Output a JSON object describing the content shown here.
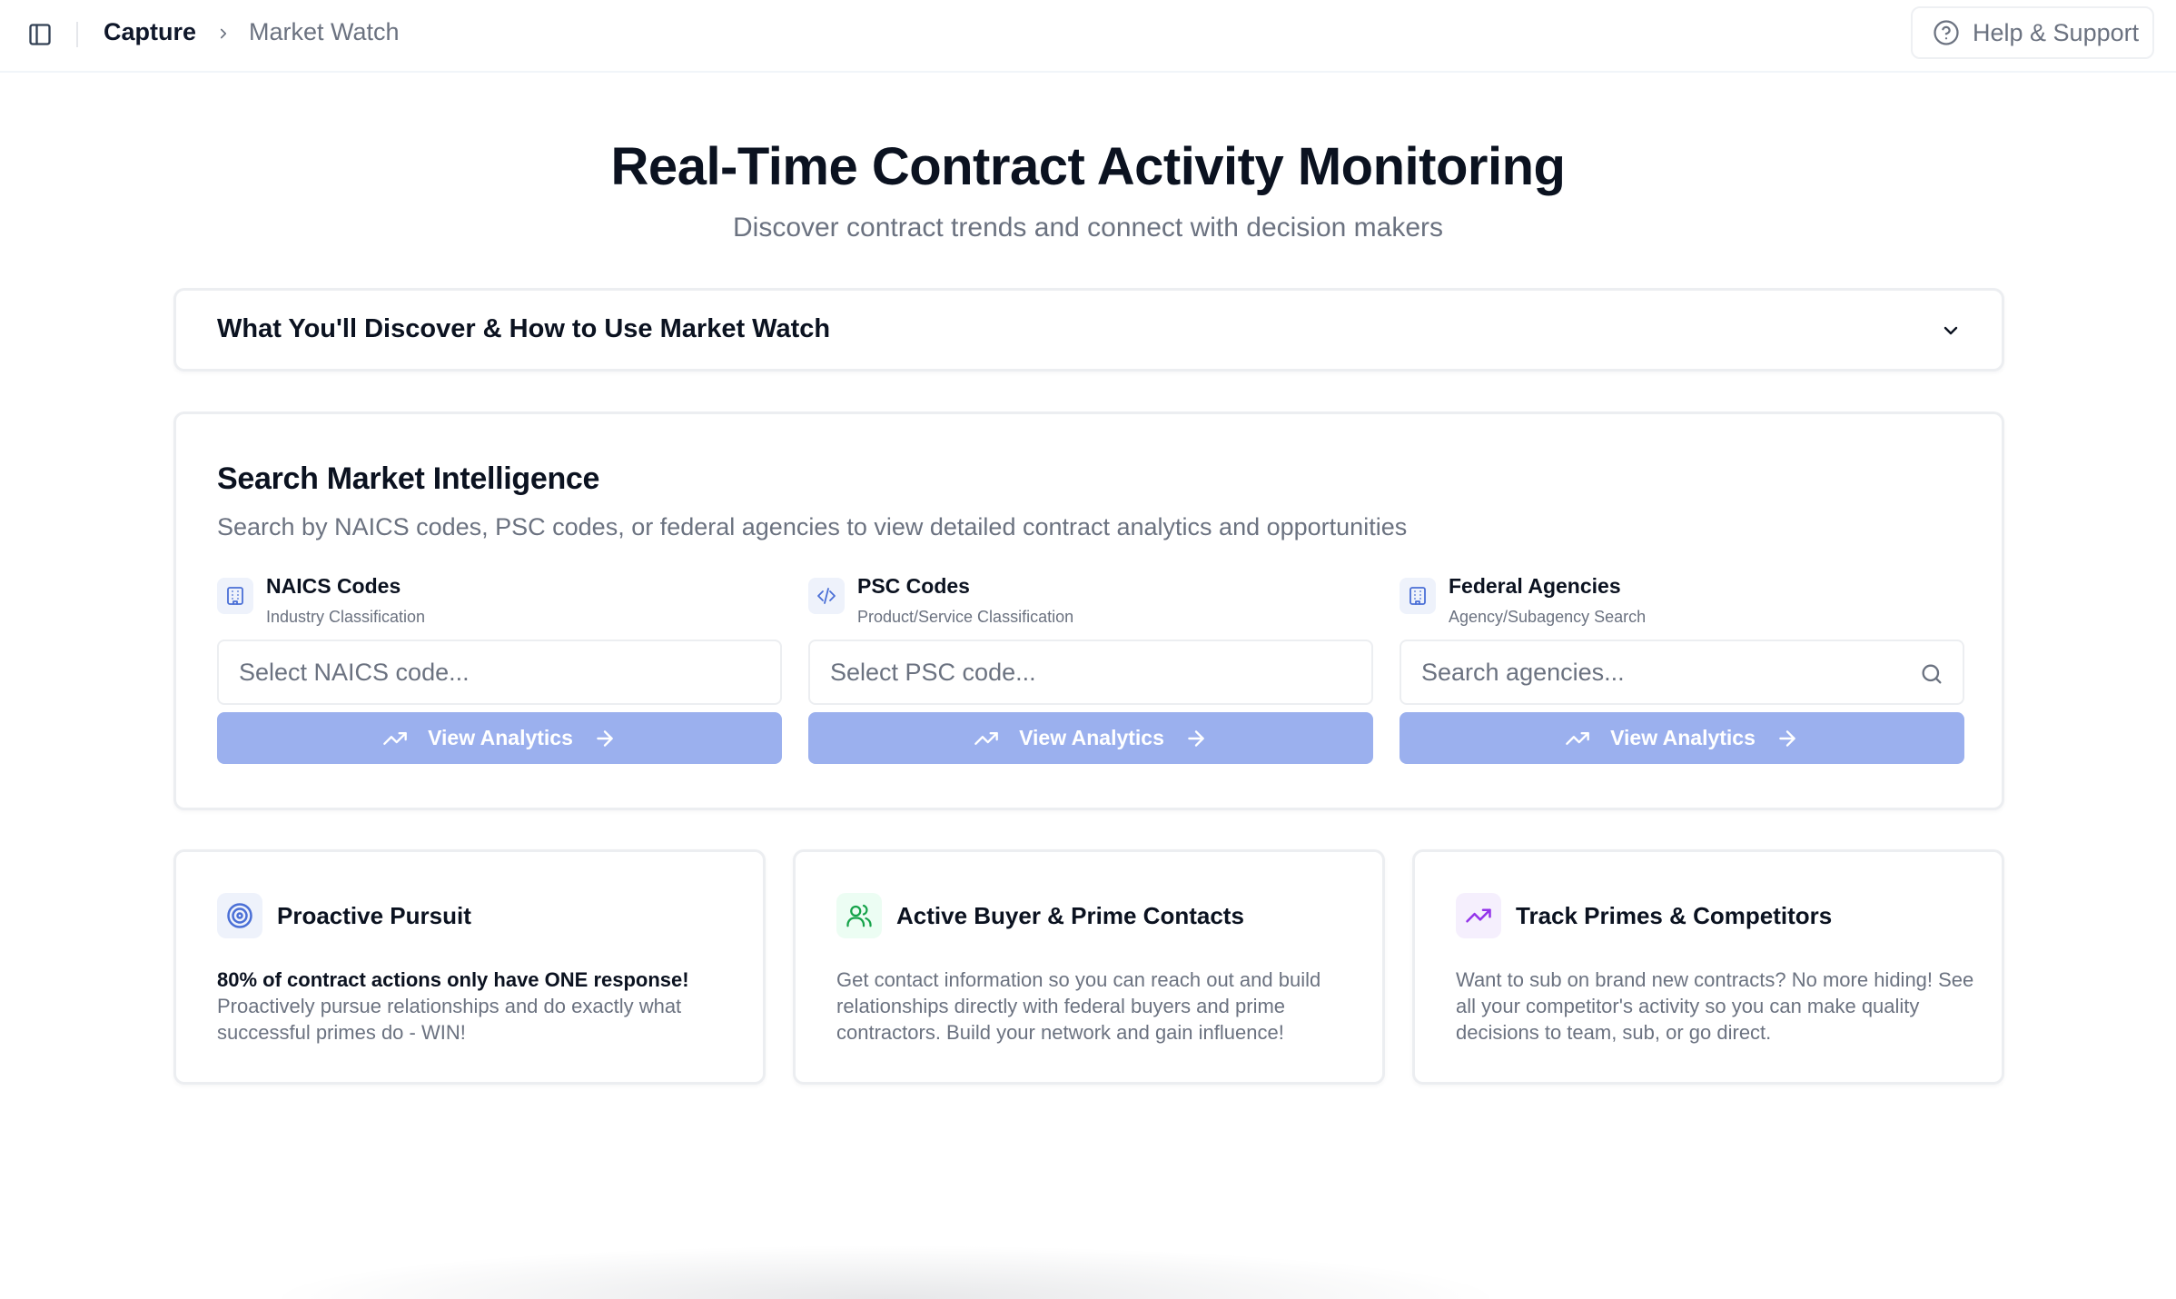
{
  "header": {
    "breadcrumb_root": "Capture",
    "breadcrumb_current": "Market Watch",
    "help_label": "Help & Support"
  },
  "hero": {
    "title": "Real-Time Contract Activity Monitoring",
    "subtitle": "Discover contract trends and connect with decision makers"
  },
  "accordion": {
    "title": "What You'll Discover & How to Use Market Watch"
  },
  "search": {
    "title": "Search Market Intelligence",
    "description": "Search by NAICS codes, PSC codes, or federal agencies to view detailed contract analytics and opportunities",
    "columns": [
      {
        "label": "NAICS Codes",
        "sublabel": "Industry Classification",
        "placeholder": "Select NAICS code...",
        "button": "View Analytics"
      },
      {
        "label": "PSC Codes",
        "sublabel": "Product/Service Classification",
        "placeholder": "Select PSC code...",
        "button": "View Analytics"
      },
      {
        "label": "Federal Agencies",
        "sublabel": "Agency/Subagency Search",
        "placeholder": "Search agencies...",
        "button": "View Analytics"
      }
    ]
  },
  "features": [
    {
      "icon": "target-icon",
      "title": "Proactive Pursuit",
      "highlight": "80% of contract actions only have ONE response!",
      "text": "Proactively pursue relationships and do exactly what successful primes do - WIN!"
    },
    {
      "icon": "users-icon",
      "title": "Active Buyer & Prime Contacts",
      "text": "Get contact information so you can reach out and build relationships directly with federal buyers and prime contractors. Build your network and gain influence!"
    },
    {
      "icon": "trending-up-icon",
      "title": "Track Primes & Competitors",
      "text": "Want to sub on brand new contracts? No more hiding! See all your competitor's activity so you can make quality decisions to team, sub, or go direct."
    }
  ],
  "colors": {
    "button_bg": "#9bb0ee",
    "icon_blue": "#4a6fd6",
    "icon_green": "#16a34a",
    "icon_purple": "#9333ea"
  }
}
